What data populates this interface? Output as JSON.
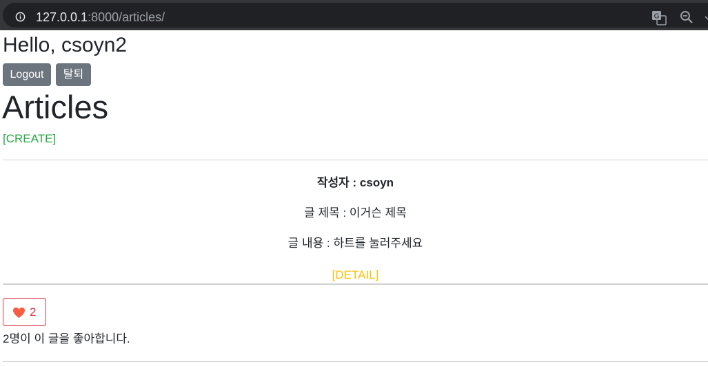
{
  "browser": {
    "url_host": "127.0.0.1",
    "url_path": ":8000/articles/",
    "icons": [
      "info-icon",
      "translate-icon",
      "zoom-out-icon",
      "more-icon"
    ]
  },
  "header": {
    "greeting": "Hello, csoyn2",
    "logout_label": "Logout",
    "withdraw_label": "탈퇴"
  },
  "main": {
    "title": "Articles",
    "create_label": "[CREATE]"
  },
  "article": {
    "author": "작성자 : csoyn",
    "title": "글 제목 : 이거슨 제목",
    "content": "글 내용 : 하트를 눌러주세요",
    "detail_label": "[DETAIL]",
    "like_count": "2",
    "like_message": "2명이 이 글을 좋아합니다."
  },
  "colors": {
    "create_link": "#28a745",
    "detail_link": "#ffc107",
    "like_border": "#dc3545",
    "heart": "#f65d42",
    "secondary_button": "#6c757d"
  }
}
